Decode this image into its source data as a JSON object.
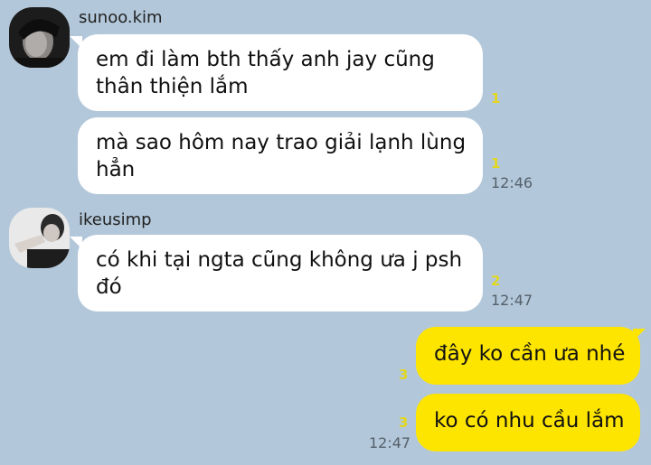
{
  "chat": {
    "messages": [
      {
        "sender": "sunoo.kim",
        "text": "em đi làm bth thấy anh jay cũng thân thiện lắm",
        "unread": "1",
        "time": ""
      },
      {
        "sender": "sunoo.kim",
        "text": "mà sao hôm nay trao giải lạnh lùng hẳn",
        "unread": "1",
        "time": "12:46"
      },
      {
        "sender": "ikeusimp",
        "text": "có khi tại ngta cũng không ưa j psh đó",
        "unread": "2",
        "time": "12:47"
      },
      {
        "sender": "me",
        "text": "đây ko cần ưa nhé",
        "unread": "3",
        "time": ""
      },
      {
        "sender": "me",
        "text": "ko có nhu cầu lắm",
        "unread": "3",
        "time": "12:47"
      }
    ]
  },
  "avatars": {
    "sunoo_icon": "profile-photo-avatar",
    "ikeusimp_icon": "profile-photo-avatar"
  },
  "colors": {
    "background": "#b2c7d9",
    "incoming_bubble": "#ffffff",
    "outgoing_bubble": "#fee500",
    "unread_count": "#e3d81e"
  }
}
